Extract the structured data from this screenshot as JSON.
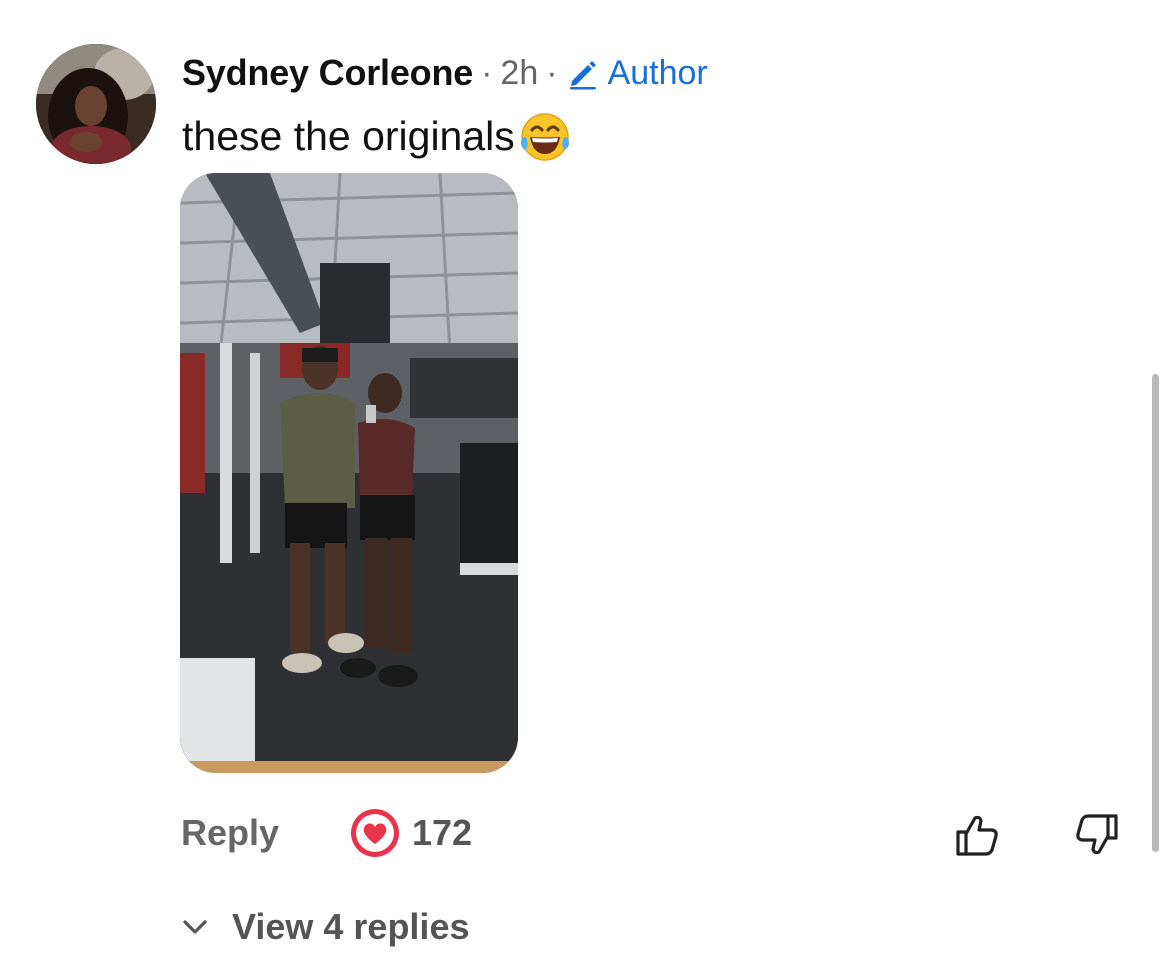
{
  "comment": {
    "author_name": "Sydney Corleone",
    "separator": "·",
    "time_ago": "2h",
    "author_badge_label": "Author",
    "body_text": "these the originals",
    "emoji": "face-with-tears-of-joy",
    "attachment": "gym mirror selfie photo"
  },
  "actions": {
    "reply_label": "Reply",
    "like_count": "172",
    "like_icon": "heart-icon",
    "upvote_icon": "thumbs-up-icon",
    "downvote_icon": "thumbs-down-icon"
  },
  "replies": {
    "toggle_label": "View 4 replies",
    "toggle_icon": "chevron-down-icon"
  },
  "colors": {
    "accent_blue": "#1a6ed8",
    "like_red": "#e8334a",
    "muted_text": "#666666"
  }
}
